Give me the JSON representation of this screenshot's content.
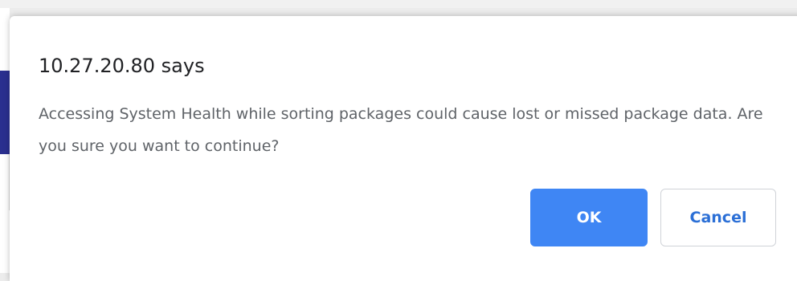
{
  "dialog": {
    "title": "10.27.20.80 says",
    "message": "Accessing System Health while sorting packages could cause lost or missed package data. Are you sure you want to continue?",
    "ok_label": "OK",
    "cancel_label": "Cancel"
  },
  "colors": {
    "ok_button": "#3f86f4",
    "cancel_text": "#2b6fd6",
    "background_bar": "#2a2f8f"
  }
}
